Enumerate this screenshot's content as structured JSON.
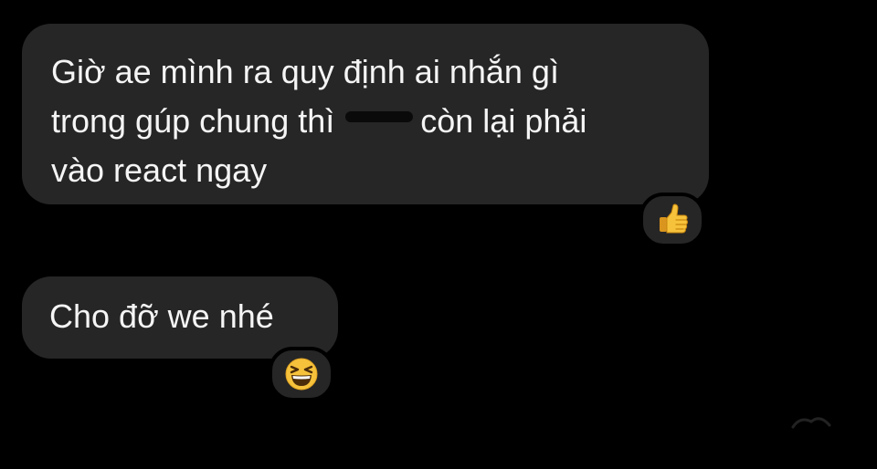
{
  "messages": [
    {
      "lines": [
        "Giờ ae mình ra quy định ai nhắn gì",
        "trong gúp chung thì",
        "còn lại phải",
        "vào react ngay"
      ],
      "reaction": "thumbs-up-icon"
    },
    {
      "lines": [
        "Cho đỡ we nhé"
      ],
      "reaction": "grinning-squinting-face-icon"
    }
  ],
  "colors": {
    "background": "#000000",
    "bubble": "#262626",
    "text": "#f5f5f5",
    "emoji_yellow": "#f6c23b"
  }
}
